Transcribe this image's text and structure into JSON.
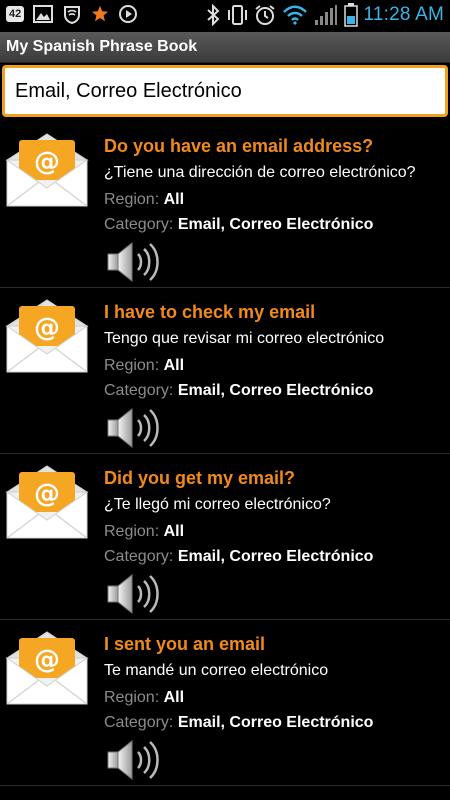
{
  "status_bar": {
    "badge": "42",
    "time": "11:28 AM",
    "icons": [
      "notification-badge-icon",
      "gallery-icon",
      "sprint-icon",
      "star-icon",
      "media-icon",
      "bluetooth-icon",
      "vibrate-icon",
      "alarm-icon",
      "wifi-icon",
      "signal-icon",
      "battery-icon"
    ]
  },
  "app": {
    "title": "My Spanish Phrase Book"
  },
  "category_field": {
    "value": "Email, Correo Electrónico"
  },
  "labels": {
    "region": "Region:",
    "category": "Category:"
  },
  "colors": {
    "accent": "#f18a1c",
    "clock": "#3ab4e6",
    "field_border": "#f0a020"
  },
  "phrases": [
    {
      "english": "Do you have an email address?",
      "spanish": "¿Tiene una dirección de correo electrónico?",
      "region": "All",
      "category": "Email, Correo Electrónico",
      "icon": "email-envelope-icon"
    },
    {
      "english": "I have to check my email",
      "spanish": "Tengo que revisar mi correo electrónico",
      "region": "All",
      "category": "Email, Correo Electrónico",
      "icon": "email-envelope-icon"
    },
    {
      "english": "Did you get my email?",
      "spanish": "¿Te llegó mi correo electrónico?",
      "region": "All",
      "category": "Email, Correo Electrónico",
      "icon": "email-envelope-icon"
    },
    {
      "english": "I sent you an email",
      "spanish": "Te mandé un correo electrónico",
      "region": "All",
      "category": "Email, Correo Electrónico",
      "icon": "email-envelope-icon"
    }
  ]
}
